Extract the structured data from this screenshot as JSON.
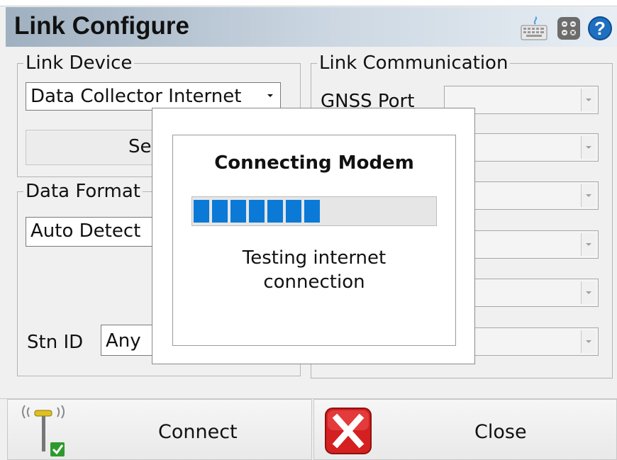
{
  "window": {
    "title": "Link Configure"
  },
  "toolbar_icons": [
    "keyboard-icon",
    "calculator-icon",
    "help-icon"
  ],
  "link_device": {
    "legend": "Link Device",
    "selected": "Data Collector Internet",
    "setup_button": "Setup"
  },
  "data_format": {
    "legend": "Data Format",
    "selected": "Auto Detect",
    "stn_id_label": "Stn ID",
    "stn_id_value": "Any"
  },
  "link_communication": {
    "legend": "Link Communication",
    "gnss_port_label": "GNSS Port",
    "fields": [
      "",
      "",
      "",
      "",
      "",
      ""
    ]
  },
  "buttons": {
    "connect": "Connect",
    "close": "Close"
  },
  "dialog": {
    "title": "Connecting Modem",
    "progress_percent": 50,
    "message_line1": "Testing internet",
    "message_line2": "connection"
  },
  "colors": {
    "progress": "#0b7ad6",
    "close_red": "#d42020",
    "check_green": "#2e9a2e"
  }
}
